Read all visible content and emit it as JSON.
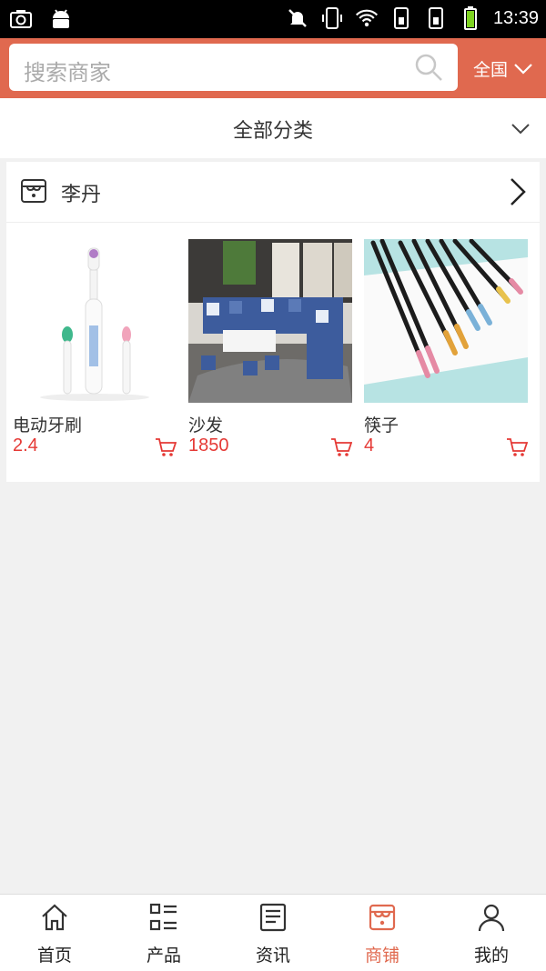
{
  "status_bar": {
    "time": "13:39"
  },
  "header": {
    "search_placeholder": "搜索商家",
    "region": "全国"
  },
  "category": {
    "label": "全部分类"
  },
  "shop": {
    "name": "李丹",
    "products": [
      {
        "name": "电动牙刷",
        "price": "2.4"
      },
      {
        "name": "沙发",
        "price": "1850"
      },
      {
        "name": "筷子",
        "price": "4"
      }
    ]
  },
  "bottom_nav": [
    {
      "label": "首页",
      "icon": "home-icon"
    },
    {
      "label": "产品",
      "icon": "list-icon"
    },
    {
      "label": "资讯",
      "icon": "news-icon"
    },
    {
      "label": "商铺",
      "icon": "store-icon",
      "active": true
    },
    {
      "label": "我的",
      "icon": "user-icon"
    }
  ],
  "colors": {
    "accent": "#e0694f",
    "price": "#e53935"
  }
}
